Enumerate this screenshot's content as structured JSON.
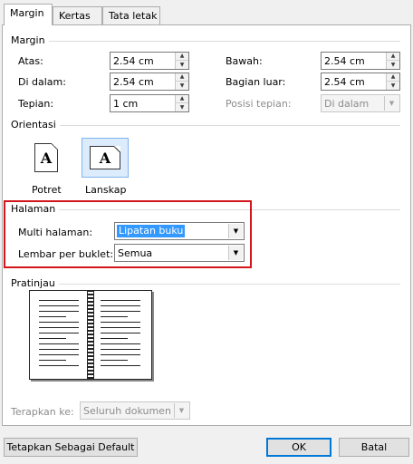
{
  "tabs": [
    "Margin",
    "Kertas",
    "Tata letak"
  ],
  "margin": {
    "title": "Margin",
    "atas_label": "Atas:",
    "atas_value": "2.54 cm",
    "bawah_label": "Bawah:",
    "bawah_value": "2.54 cm",
    "di_dalam_label": "Di dalam:",
    "di_dalam_value": "2.54 cm",
    "bagian_luar_label": "Bagian luar:",
    "bagian_luar_value": "2.54 cm",
    "tepian_label": "Tepian:",
    "tepian_value": "1 cm",
    "posisi_tepian_label": "Posisi tepian:",
    "posisi_tepian_value": "Di dalam"
  },
  "orientasi": {
    "title": "Orientasi",
    "potret_label": "Potret",
    "lanskap_label": "Lanskap",
    "icon_letter": "A"
  },
  "halaman": {
    "title": "Halaman",
    "multi_label": "Multi halaman:",
    "multi_value": "Lipatan buku",
    "lembar_label": "Lembar per buklet:",
    "lembar_value": "Semua"
  },
  "pratinjau": {
    "title": "Pratinjau"
  },
  "terapkan": {
    "label": "Terapkan ke:",
    "value": "Seluruh dokumen"
  },
  "buttons": {
    "default": "Tetapkan Sebagai Default",
    "ok": "OK",
    "cancel": "Batal"
  }
}
